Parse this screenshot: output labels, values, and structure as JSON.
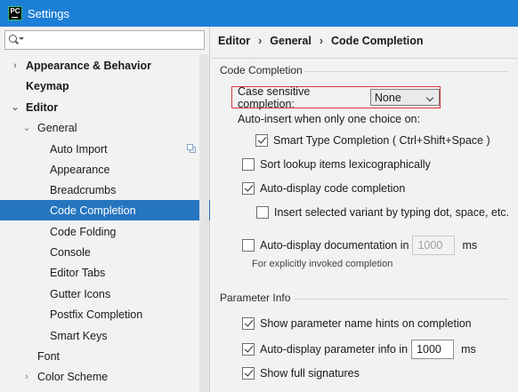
{
  "window": {
    "title": "Settings",
    "icon_text": "PC"
  },
  "search": {
    "placeholder": ""
  },
  "sidebar": {
    "items": [
      {
        "label": "Appearance & Behavior",
        "arrow": "›"
      },
      {
        "label": "Keymap"
      },
      {
        "label": "Editor",
        "arrow": "⌄"
      },
      {
        "label": "General",
        "arrow": "⌄"
      },
      {
        "label": "Auto Import"
      },
      {
        "label": "Appearance"
      },
      {
        "label": "Breadcrumbs"
      },
      {
        "label": "Code Completion"
      },
      {
        "label": "Code Folding"
      },
      {
        "label": "Console"
      },
      {
        "label": "Editor Tabs"
      },
      {
        "label": "Gutter Icons"
      },
      {
        "label": "Postfix Completion"
      },
      {
        "label": "Smart Keys"
      },
      {
        "label": "Font"
      },
      {
        "label": "Color Scheme",
        "arrow": "›"
      }
    ]
  },
  "breadcrumb": {
    "parts": [
      "Editor",
      "General",
      "Code Completion"
    ],
    "separator": "›"
  },
  "code_completion": {
    "section_title": "Code Completion",
    "case_sensitive_label": "Case sensitive completion:",
    "case_sensitive_value": "None",
    "auto_insert_label": "Auto-insert when only one choice on:",
    "smart_type_label": "Smart Type Completion ( Ctrl+Shift+Space )",
    "smart_type_checked": true,
    "sort_lookup_label": "Sort lookup items lexicographically",
    "sort_lookup_checked": false,
    "auto_display_label": "Auto-display code completion",
    "auto_display_checked": true,
    "insert_selected_label": "Insert selected variant by typing dot, space, etc.",
    "insert_selected_checked": false,
    "auto_doc_label": "Auto-display documentation in",
    "auto_doc_checked": false,
    "auto_doc_value": "1000",
    "auto_doc_unit": "ms",
    "auto_doc_hint": "For explicitly invoked completion"
  },
  "parameter_info": {
    "section_title": "Parameter Info",
    "show_hints_label": "Show parameter name hints on completion",
    "show_hints_checked": true,
    "auto_param_label": "Auto-display parameter info in",
    "auto_param_checked": true,
    "auto_param_value": "1000",
    "auto_param_unit": "ms",
    "full_signatures_label": "Show full signatures",
    "full_signatures_checked": true
  },
  "colors": {
    "titlebar": "#1c7fd6",
    "selection": "#2675bf",
    "highlight_border": "#d93a3a"
  }
}
